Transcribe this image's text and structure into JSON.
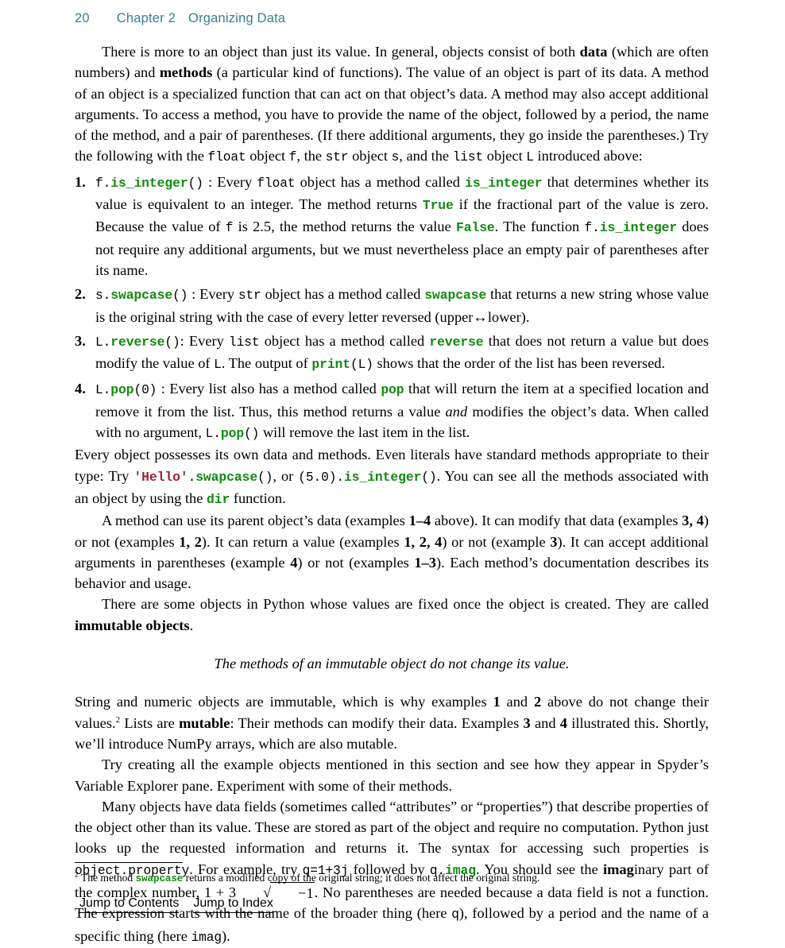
{
  "header": {
    "page_number": "20",
    "chapter": "Chapter 2",
    "section": "Organizing Data",
    "color": "#3b7d90"
  },
  "colors": {
    "code_green": "#128a12",
    "string_maroon": "#9b2335",
    "header_teal": "#3b7d90",
    "body_text": "#000000",
    "page_background": "#ffffff"
  },
  "body": {
    "p1": {
      "t1": "There is more to an object than just its value. In general, objects consist of both ",
      "b1": "data",
      "t2": " (which are often numbers) and ",
      "b2": "methods",
      "t3": " (a particular kind of functions). The value of an object is part of its data. A method of an object is a specialized function that can act on that object’s data. A method may also accept additional arguments. To access a method, you have to provide the name of the object, followed by a period, the name of the method, and a pair of parentheses. (If there additional arguments, they go inside the parentheses.) Try the following with the ",
      "c1": "float",
      "t4": " object ",
      "c2": "f",
      "t5": ", the ",
      "c3": "str",
      "t6": " object ",
      "c4": "s",
      "t7": ", and the ",
      "c5": "list",
      "t8": " object ",
      "c6": "L",
      "t9": " introduced above:"
    },
    "list": [
      {
        "num": "1.",
        "c_obj": "f.",
        "c_method": "is_integer",
        "c_paren": "()",
        "t1": " : Every ",
        "c1": "float",
        "t2": " object has a method called ",
        "k1": "is_integer",
        "t3": " that determines whether its value is equivalent to an integer. The method returns ",
        "k2": "True",
        "t4": " if the fractional part of the value is zero. Because the value of ",
        "c2": "f",
        "t5": " is 2.5, the method returns the value ",
        "k3": "False",
        "t6": ". The function ",
        "c3": "f.",
        "k4": "is_integer",
        "t7": " does not require any additional arguments, but we must nevertheless place an empty pair of parentheses after its name."
      },
      {
        "num": "2.",
        "c_obj": "s.",
        "c_method": "swapcase",
        "c_paren": "()",
        "t1": " : Every ",
        "c1": "str",
        "t2": " object has a method called ",
        "k1": "swapcase",
        "t3": " that returns a new string whose value is the original string with the case of every letter reversed (upper↔lower)."
      },
      {
        "num": "3.",
        "c_obj": "L.",
        "c_method": "reverse",
        "c_paren": "()",
        "t1": ": Every ",
        "c1": "list",
        "t2": " object has a method called ",
        "k1": "reverse",
        "t3": " that does not return a value but does modify the value of ",
        "c2": "L",
        "t4": ". The output of ",
        "k2": "print",
        "c3": "(L)",
        "t5": " shows that the order of the list has been reversed."
      },
      {
        "num": "4.",
        "c_obj": "L.",
        "c_method": "pop",
        "c_paren": "(0)",
        "t1": " : Every list also has a method called ",
        "k1": "pop",
        "t2": " that will return the item at a specified location and remove it from the list. Thus, this method returns a value ",
        "i1": "and",
        "t3": " modifies the object’s data. When called with no argument, ",
        "c2": "L.",
        "k2": "pop",
        "c3": "()",
        "t4": " will remove the last item in the list."
      }
    ],
    "p2": {
      "t1": "Every object possesses its own data and methods. Even literals have standard methods appropriate to their type: Try ",
      "s1": "'Hello'",
      "c1": ".",
      "k1": "swapcase",
      "c2": "()",
      "t2": ", or ",
      "c3": "(5.0).",
      "k2": "is_integer",
      "c4": "()",
      "t3": ". You can see all the methods associated with an object by using the ",
      "k3": "dir",
      "t4": " function."
    },
    "p3": {
      "t1": "A method can use its parent object’s data (examples ",
      "b1": "1–4",
      "t2": " above). It can modify that data (examples ",
      "b2": "3, 4",
      "t3": ") or not (examples ",
      "b3": "1, 2",
      "t4": "). It can return a value (examples ",
      "b4": "1, 2, 4",
      "t5": ") or not (example ",
      "b5": "3",
      "t6": "). It can accept additional arguments in parentheses (example ",
      "b6": "4",
      "t7": ") or not (examples ",
      "b7": "1–3",
      "t8": "). Each method’s documentation describes its behavior and usage."
    },
    "p4": {
      "t1": "There are some objects in Python whose values are fixed once the object is created. They are called ",
      "b1": "immutable objects",
      "t2": "."
    },
    "callout": "The methods of an immutable object do not change its value.",
    "p5": {
      "t1": "String and numeric objects are immutable, which is why examples ",
      "b1": "1",
      "t2": " and ",
      "b2": "2",
      "t3": " above do not change their values.",
      "fn": "2",
      "t4": " Lists are ",
      "b3": "mutable",
      "t5": ": Their methods can modify their data. Examples ",
      "b4": "3",
      "t6": " and ",
      "b5": "4",
      "t7": " illustrated this. Shortly, we’ll introduce NumPy arrays, which are also mutable."
    },
    "p6": "Try creating all the example objects mentioned in this section and see how they appear in Spyder’s Variable Explorer pane. Experiment with some of their methods.",
    "p7": {
      "t1": "Many objects have data fields (sometimes called “attributes” or “properties”) that describe properties of the object other than its value. These are stored as part of the object and require no computation. Python just looks up the requested information and returns it. The syntax for accessing such properties is ",
      "c1": "object.property",
      "t2": ". For example, try ",
      "c2": "q=1+3j",
      "t3": " followed by ",
      "c3": "q.",
      "k1": "imag",
      "t4": ". You should see the ",
      "b1": "imag",
      "t5": "inary part of the complex number, ",
      "math_lead": "1 + 3",
      "math_radicand": "−1",
      "t6": ". No parentheses are needed because a data field is not a function. The expression starts with the name of the broader thing (here ",
      "c4": "q",
      "t7": "), followed by a period and the name of a specific thing (here ",
      "c5": "imag",
      "t8": ")."
    }
  },
  "footnote": {
    "marker": "2",
    "t1": " The method ",
    "k1": "swapcase",
    "t2": " returns a modified copy of the original string; it does not affect the original string."
  },
  "footer": {
    "jump_to_contents": "Jump to Contents",
    "jump_to_index": "Jump to Index"
  }
}
